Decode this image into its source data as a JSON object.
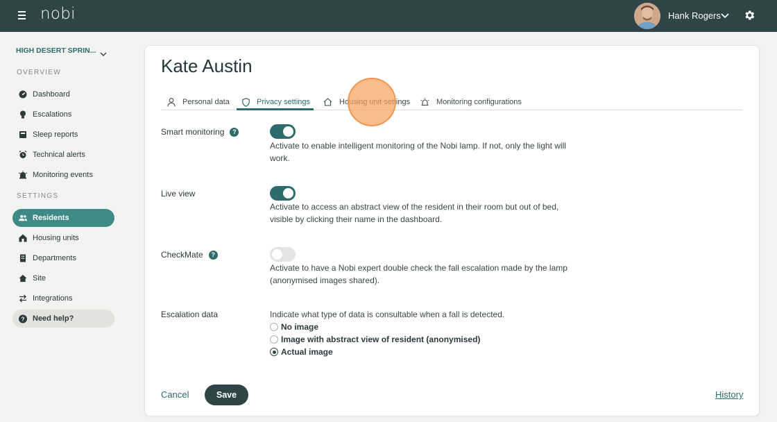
{
  "app": {
    "logo": "nobi"
  },
  "user": {
    "name": "Hank Rogers"
  },
  "sidebar": {
    "site_name": "HIGH DESERT SPRIN...",
    "overview_title": "OVERVIEW",
    "settings_title": "SETTINGS",
    "overview_items": [
      {
        "label": "Dashboard",
        "icon": "dashboard-icon"
      },
      {
        "label": "Escalations",
        "icon": "bulb-icon"
      },
      {
        "label": "Sleep reports",
        "icon": "bed-icon"
      },
      {
        "label": "Technical alerts",
        "icon": "alarm-clock-icon"
      },
      {
        "label": "Monitoring events",
        "icon": "siren-icon"
      }
    ],
    "settings_items": [
      {
        "label": "Residents",
        "icon": "people-icon",
        "active": true
      },
      {
        "label": "Housing units",
        "icon": "house-icon"
      },
      {
        "label": "Departments",
        "icon": "building-icon"
      },
      {
        "label": "Site",
        "icon": "home-icon"
      },
      {
        "label": "Integrations",
        "icon": "arrows-icon"
      }
    ],
    "help_label": "Need help?"
  },
  "page": {
    "title": "Kate Austin",
    "tabs": [
      {
        "label": "Personal data",
        "icon": "person-icon"
      },
      {
        "label": "Privacy settings",
        "icon": "shield-icon",
        "active": true
      },
      {
        "label": "Housing unit settings",
        "icon": "house-outline-icon"
      },
      {
        "label": "Monitoring configurations",
        "icon": "siren-outline-icon"
      }
    ]
  },
  "settings": {
    "smart_monitoring": {
      "label": "Smart monitoring",
      "enabled": true,
      "description": "Activate to enable intelligent monitoring of the Nobi lamp. If not, only the light will work."
    },
    "live_view": {
      "label": "Live view",
      "enabled": true,
      "description": "Activate to access an abstract view of the resident in their room but out of bed, visible by clicking their name in the dashboard."
    },
    "checkmate": {
      "label": "CheckMate",
      "enabled": false,
      "description": "Activate to have a Nobi expert double check the fall escalation made by the lamp (anonymised images shared)."
    },
    "escalation_data": {
      "label": "Escalation data",
      "description": "Indicate what type of data is consultable when a fall is detected.",
      "options": [
        "No image",
        "Image with abstract view of resident (anonymised)",
        "Actual image"
      ],
      "selected": "Actual image"
    }
  },
  "actions": {
    "cancel": "Cancel",
    "save": "Save",
    "history": "History"
  },
  "colors": {
    "topbar": "#2e4447",
    "accent": "#2e6b6d",
    "active_nav": "#3d8a86"
  }
}
